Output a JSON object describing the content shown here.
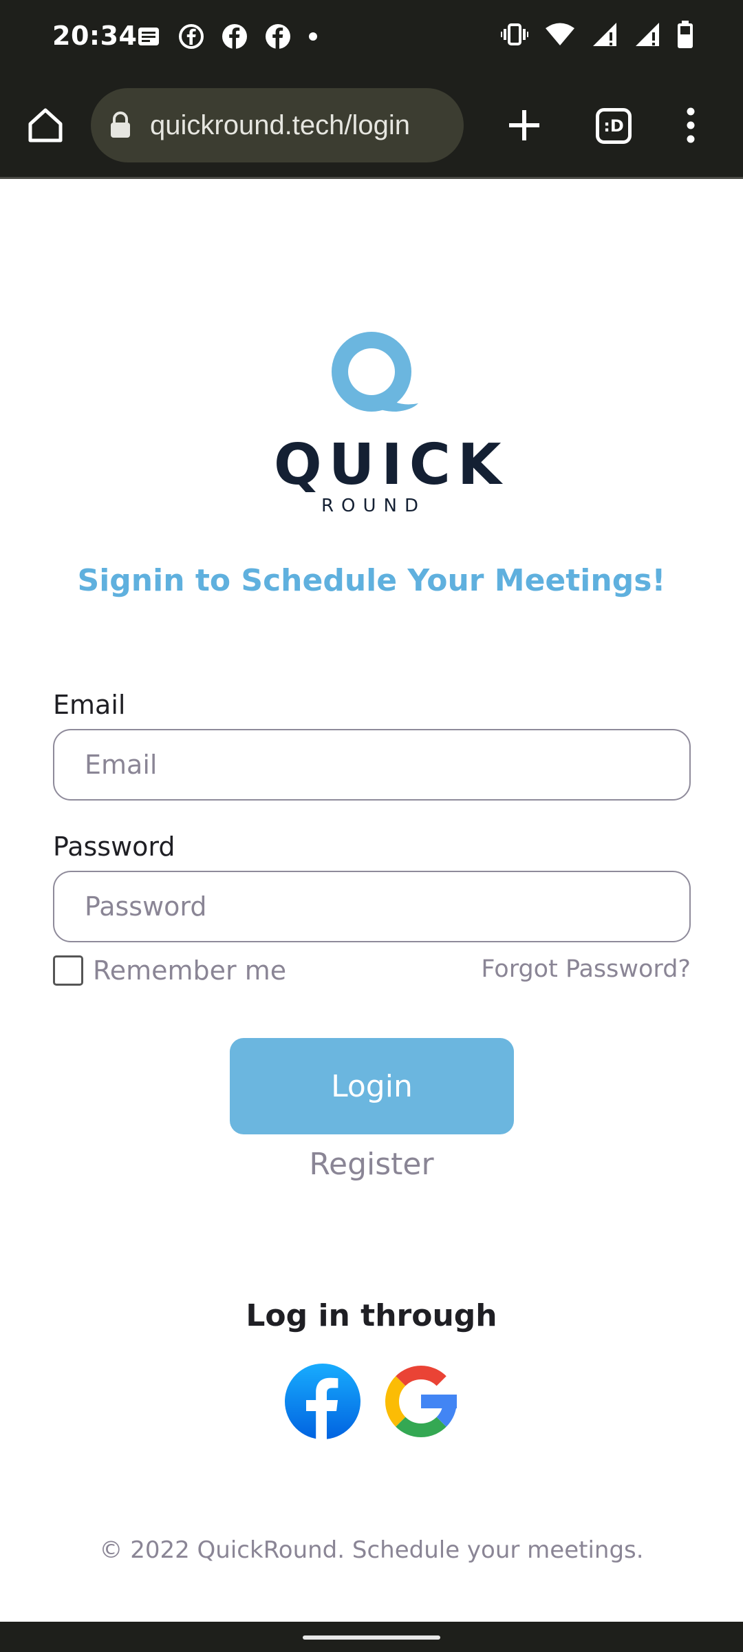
{
  "status_bar": {
    "time": "20:34",
    "left_icons": [
      "news-icon",
      "facebook-outline-icon",
      "facebook-icon",
      "facebook-icon",
      "dot-icon"
    ],
    "right_icons": [
      "vibrate-icon",
      "wifi-icon",
      "signal-icon",
      "signal-icon",
      "battery-icon"
    ]
  },
  "browser": {
    "url": "quickround.tech/login",
    "tabs_label": ":D"
  },
  "logo": {
    "line1": "QUICK",
    "line2": "ROUND"
  },
  "headline": "Signin to Schedule Your Meetings!",
  "form": {
    "email_label": "Email",
    "email_placeholder": "Email",
    "password_label": "Password",
    "password_placeholder": "Password",
    "remember_label": "Remember me",
    "forgot_label": "Forgot Password?",
    "login_label": "Login",
    "register_label": "Register"
  },
  "social": {
    "heading": "Log in through",
    "providers": [
      "facebook-icon",
      "google-icon"
    ]
  },
  "footer": "© 2022 QuickRound. Schedule your meetings.",
  "colors": {
    "accent": "#6bb6df",
    "headline": "#5fb0de",
    "chrome_bg": "#1e1f1b",
    "muted_text": "#8a8595"
  }
}
